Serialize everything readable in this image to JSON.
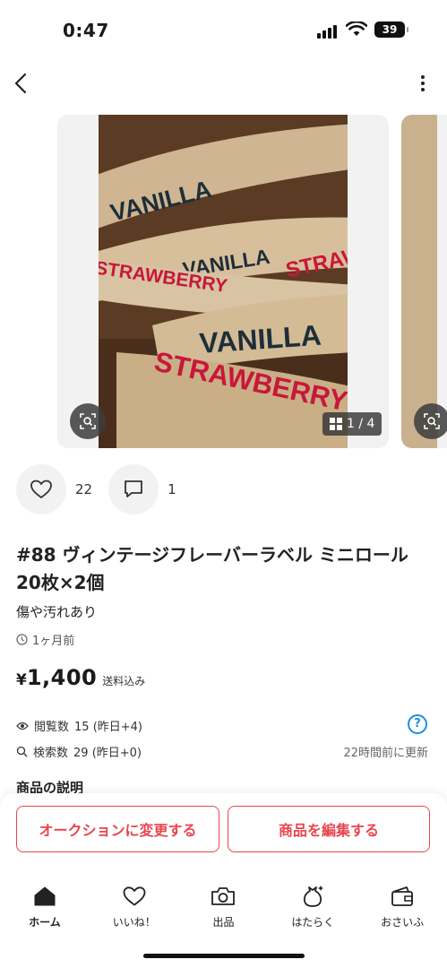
{
  "status_bar": {
    "time": "0:47",
    "battery": "39"
  },
  "gallery": {
    "photo_words": [
      "VANILLA",
      "STRAWBERRY",
      "STRAWBERRY",
      "VANILLA",
      "STRAWBERRY"
    ],
    "page_counter": "1 / 4"
  },
  "actions": {
    "likes": "22",
    "comments": "1"
  },
  "item": {
    "title": "#88 ヴィンテージフレーバーラベル ミニロール20枚×2個",
    "condition": "傷や汚れあり",
    "posted": "1ヶ月前",
    "price_symbol": "¥",
    "price": "1,400",
    "shipping": "送料込み"
  },
  "stats": {
    "views_label": "閲覧数",
    "views": "15 (昨日+4)",
    "searches_label": "検索数",
    "searches": "29 (昨日+0)",
    "updated": "22時間前に更新",
    "help": "?"
  },
  "description_heading": "商品の説明",
  "buttons": {
    "auction": "オークションに変更する",
    "edit": "商品を編集する"
  },
  "tabs": [
    {
      "label": "ホーム",
      "icon": "home-icon"
    },
    {
      "label": "いいね！",
      "icon": "heart-icon"
    },
    {
      "label": "出品",
      "icon": "camera-icon"
    },
    {
      "label": "はたらく",
      "icon": "money-bag-icon"
    },
    {
      "label": "おさいふ",
      "icon": "wallet-icon"
    }
  ],
  "colors": {
    "accent": "#e8454e",
    "help_blue": "#1a8fe0"
  }
}
